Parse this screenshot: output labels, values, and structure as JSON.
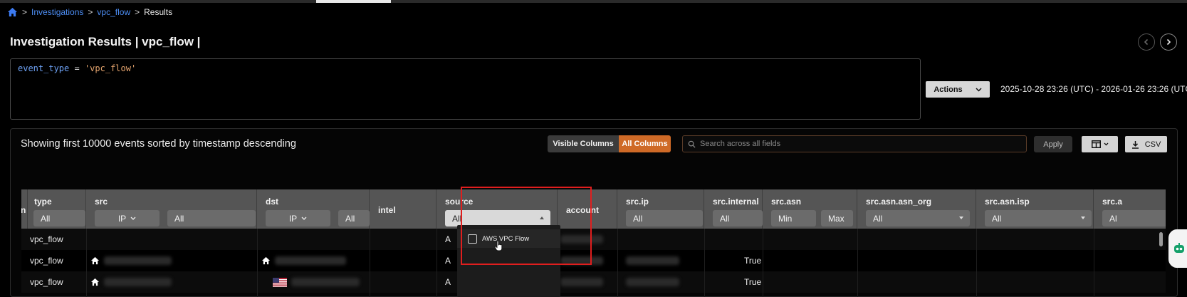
{
  "breadcrumb": {
    "items": [
      "Investigations",
      "vpc_flow"
    ],
    "current": "Results",
    "separator": ">"
  },
  "page": {
    "title": "Investigation Results | vpc_flow |"
  },
  "query": {
    "field": "event_type",
    "operator": "=",
    "value": "'vpc_flow'"
  },
  "toolbar": {
    "actions_label": "Actions",
    "date_range": "2025-10-28 23:26 (UTC) - 2026-01-26 23:26 (UTC)"
  },
  "results": {
    "summary": "Showing first 10000 events sorted by timestamp descending",
    "visible_columns_label": "Visible Columns",
    "all_columns_label": "All Columns",
    "search_placeholder": "Search across all fields",
    "apply_label": "Apply",
    "csv_label": "CSV"
  },
  "table": {
    "headers": {
      "type": "type",
      "src": "src",
      "dst": "dst",
      "intel": "intel",
      "source": "source",
      "account": "account",
      "src_ip": "src.ip",
      "src_internal": "src.internal",
      "src_asn": "src.asn",
      "src_asn_org": "src.asn.asn_org",
      "src_asn_isp": "src.asn.isp",
      "clipped": "src.a",
      "clipped_left": "n"
    },
    "filters": {
      "all": "All",
      "ip": "IP",
      "min": "Min",
      "max": "Max",
      "source_value": "All",
      "clipped": "Al"
    },
    "rows": [
      {
        "type": "vpc_flow",
        "source": "A",
        "src_internal": ""
      },
      {
        "type": "vpc_flow",
        "source": "A",
        "src_internal": "True"
      },
      {
        "type": "vpc_flow",
        "source": "A",
        "src_internal": "True"
      }
    ]
  },
  "source_dropdown": {
    "option": "AWS VPC Flow"
  },
  "colors": {
    "accent_orange": "#cf6a27",
    "link_blue": "#4d8ef5",
    "highlight_red": "#e01e1e",
    "header_gray": "#555555"
  }
}
